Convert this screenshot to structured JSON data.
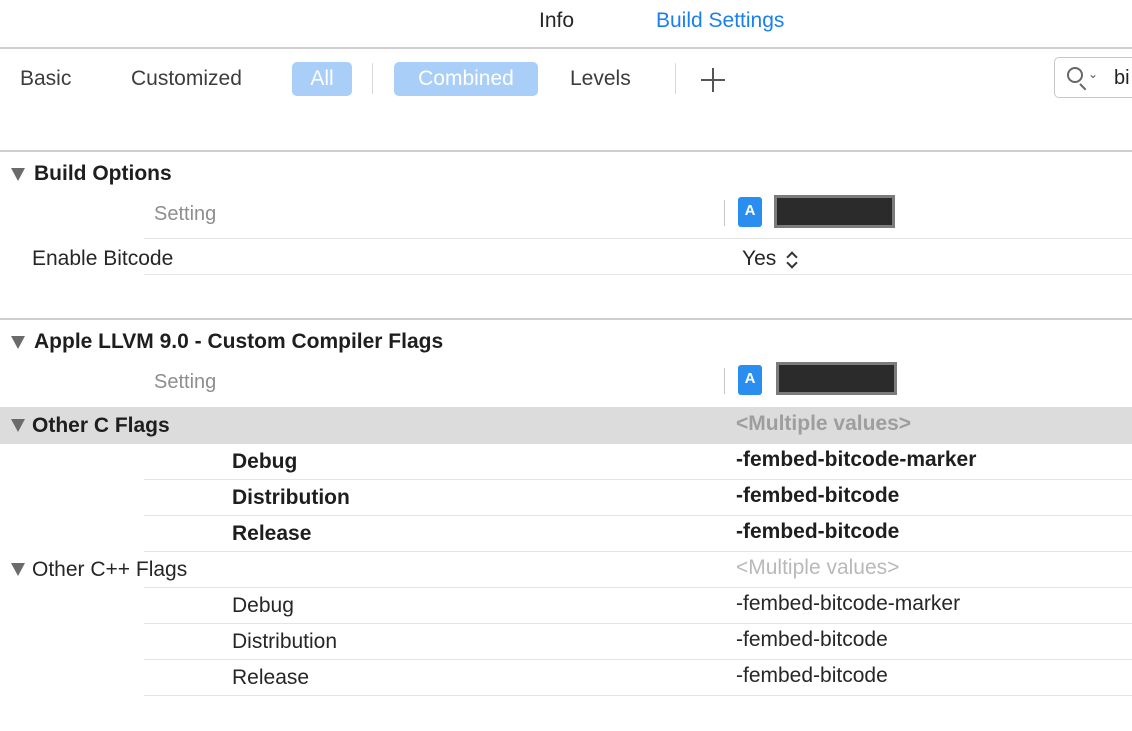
{
  "top_tabs": {
    "info": "Info",
    "build_settings": "Build Settings"
  },
  "toolbar": {
    "basic": "Basic",
    "customized": "Customized",
    "all": "All",
    "combined": "Combined",
    "levels": "Levels",
    "search_text": "bi"
  },
  "build_options": {
    "title": "Build Options",
    "column_header": "Setting",
    "enable_bitcode": {
      "name": "Enable Bitcode",
      "value": "Yes"
    }
  },
  "compiler_flags": {
    "title": "Apple LLVM 9.0 - Custom Compiler Flags",
    "column_header": "Setting",
    "other_c_flags": {
      "name": "Other C Flags",
      "value": "<Multiple values>",
      "configs": [
        {
          "name": "Debug",
          "value": "-fembed-bitcode-marker"
        },
        {
          "name": "Distribution",
          "value": "-fembed-bitcode"
        },
        {
          "name": "Release",
          "value": "-fembed-bitcode"
        }
      ]
    },
    "other_cpp_flags": {
      "name": "Other C++ Flags",
      "value": "<Multiple values>",
      "configs": [
        {
          "name": "Debug",
          "value": "-fembed-bitcode-marker"
        },
        {
          "name": "Distribution",
          "value": "-fembed-bitcode"
        },
        {
          "name": "Release",
          "value": "-fembed-bitcode"
        }
      ]
    }
  },
  "colors": {
    "accent": "#1a7ff0",
    "pill": "#a9cef8",
    "selected_row": "#dcdcdc"
  }
}
